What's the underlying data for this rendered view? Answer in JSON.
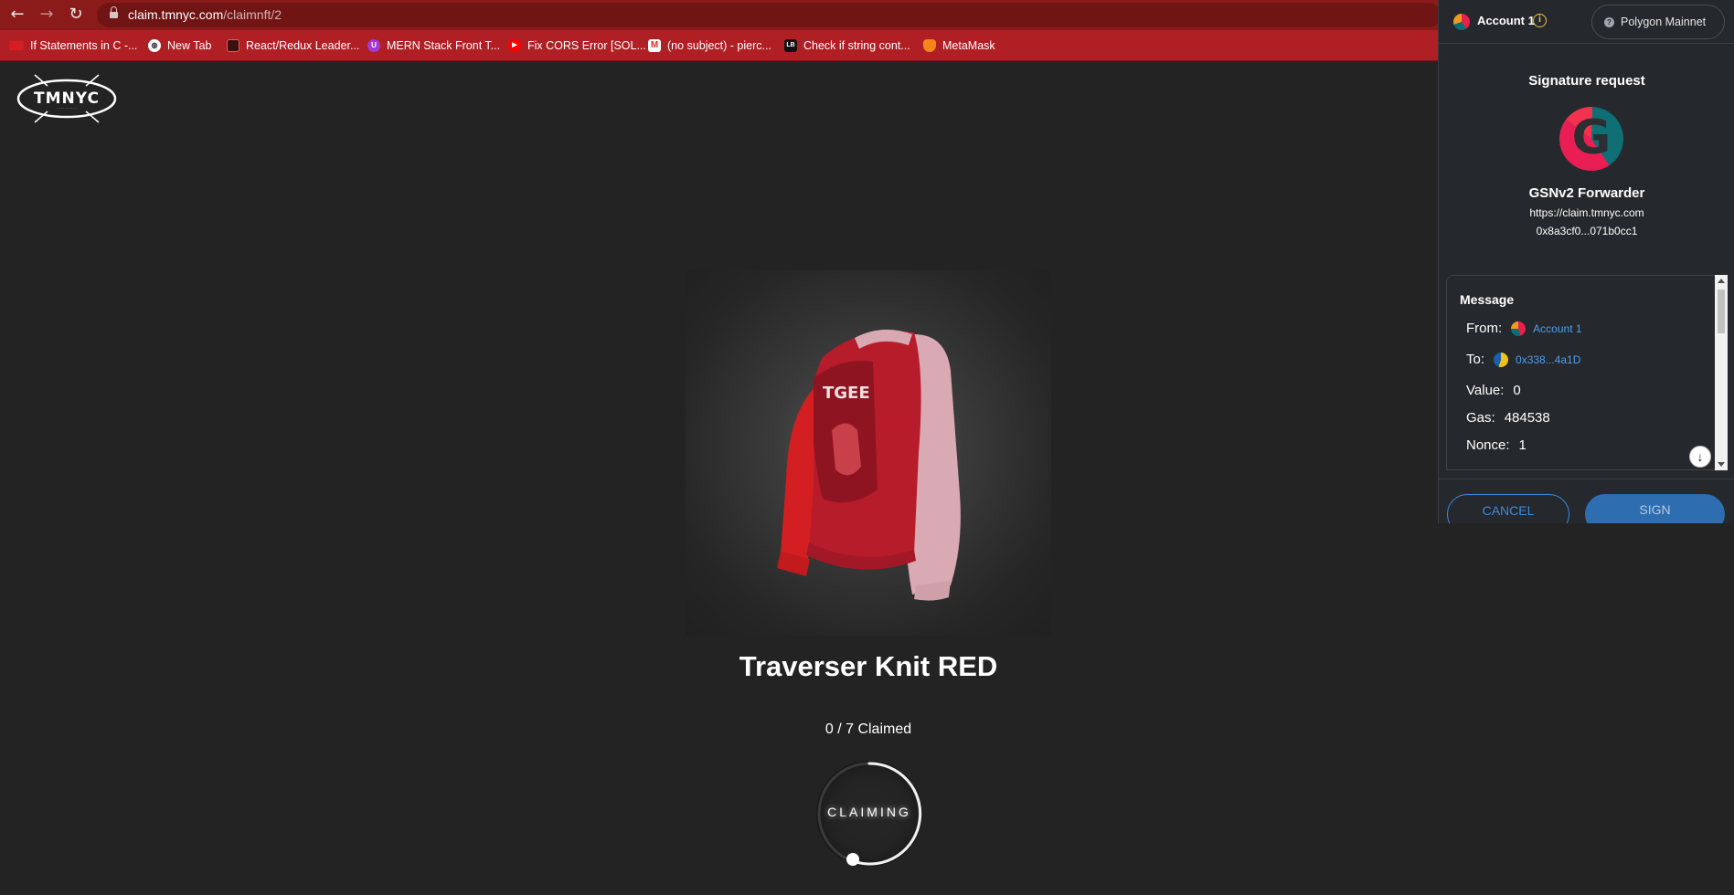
{
  "browser": {
    "url_host": "claim.tmnyc.com",
    "url_path": "/claimnft/2",
    "bookmarks": [
      {
        "label": "If Statements in C -...",
        "icon": "red-bookmark-icon"
      },
      {
        "label": "New Tab",
        "icon": "globe-icon"
      },
      {
        "label": "React/Redux Leader...",
        "icon": "dark-square-icon"
      },
      {
        "label": "MERN Stack Front T...",
        "icon": "purple-shield-icon"
      },
      {
        "label": "Fix CORS Error [SOL...",
        "icon": "youtube-icon"
      },
      {
        "label": "(no subject) - pierc...",
        "icon": "gmail-icon"
      },
      {
        "label": "Check if string cont...",
        "icon": "lb-icon"
      },
      {
        "label": "MetaMask",
        "icon": "metamask-fox-icon"
      }
    ]
  },
  "page": {
    "logo_text": "TMNYC",
    "product_title": "Traverser Knit RED",
    "claimed_text": "0 / 7 Claimed",
    "claim_button_label": "CLAIMING"
  },
  "metamask": {
    "account_name": "Account 1",
    "network": "Polygon Mainnet",
    "title": "Signature request",
    "contract_name": "GSNv2 Forwarder",
    "origin": "https://claim.tmnyc.com",
    "contract_address": "0x8a3cf0...071b0cc1",
    "message": {
      "title": "Message",
      "from_label": "From:",
      "from_value": "Account 1",
      "to_label": "To:",
      "to_value": "0x338...4a1D",
      "value_label": "Value:",
      "value_value": "0",
      "gas_label": "Gas:",
      "gas_value": "484538",
      "nonce_label": "Nonce:",
      "nonce_value": "1"
    },
    "cancel_label": "CANCEL",
    "sign_label": "SIGN"
  },
  "colors": {
    "browser_accent": "#b01f24",
    "page_bg": "#232323",
    "mm_bg": "#25282c",
    "mm_link": "#4d9ff0"
  }
}
